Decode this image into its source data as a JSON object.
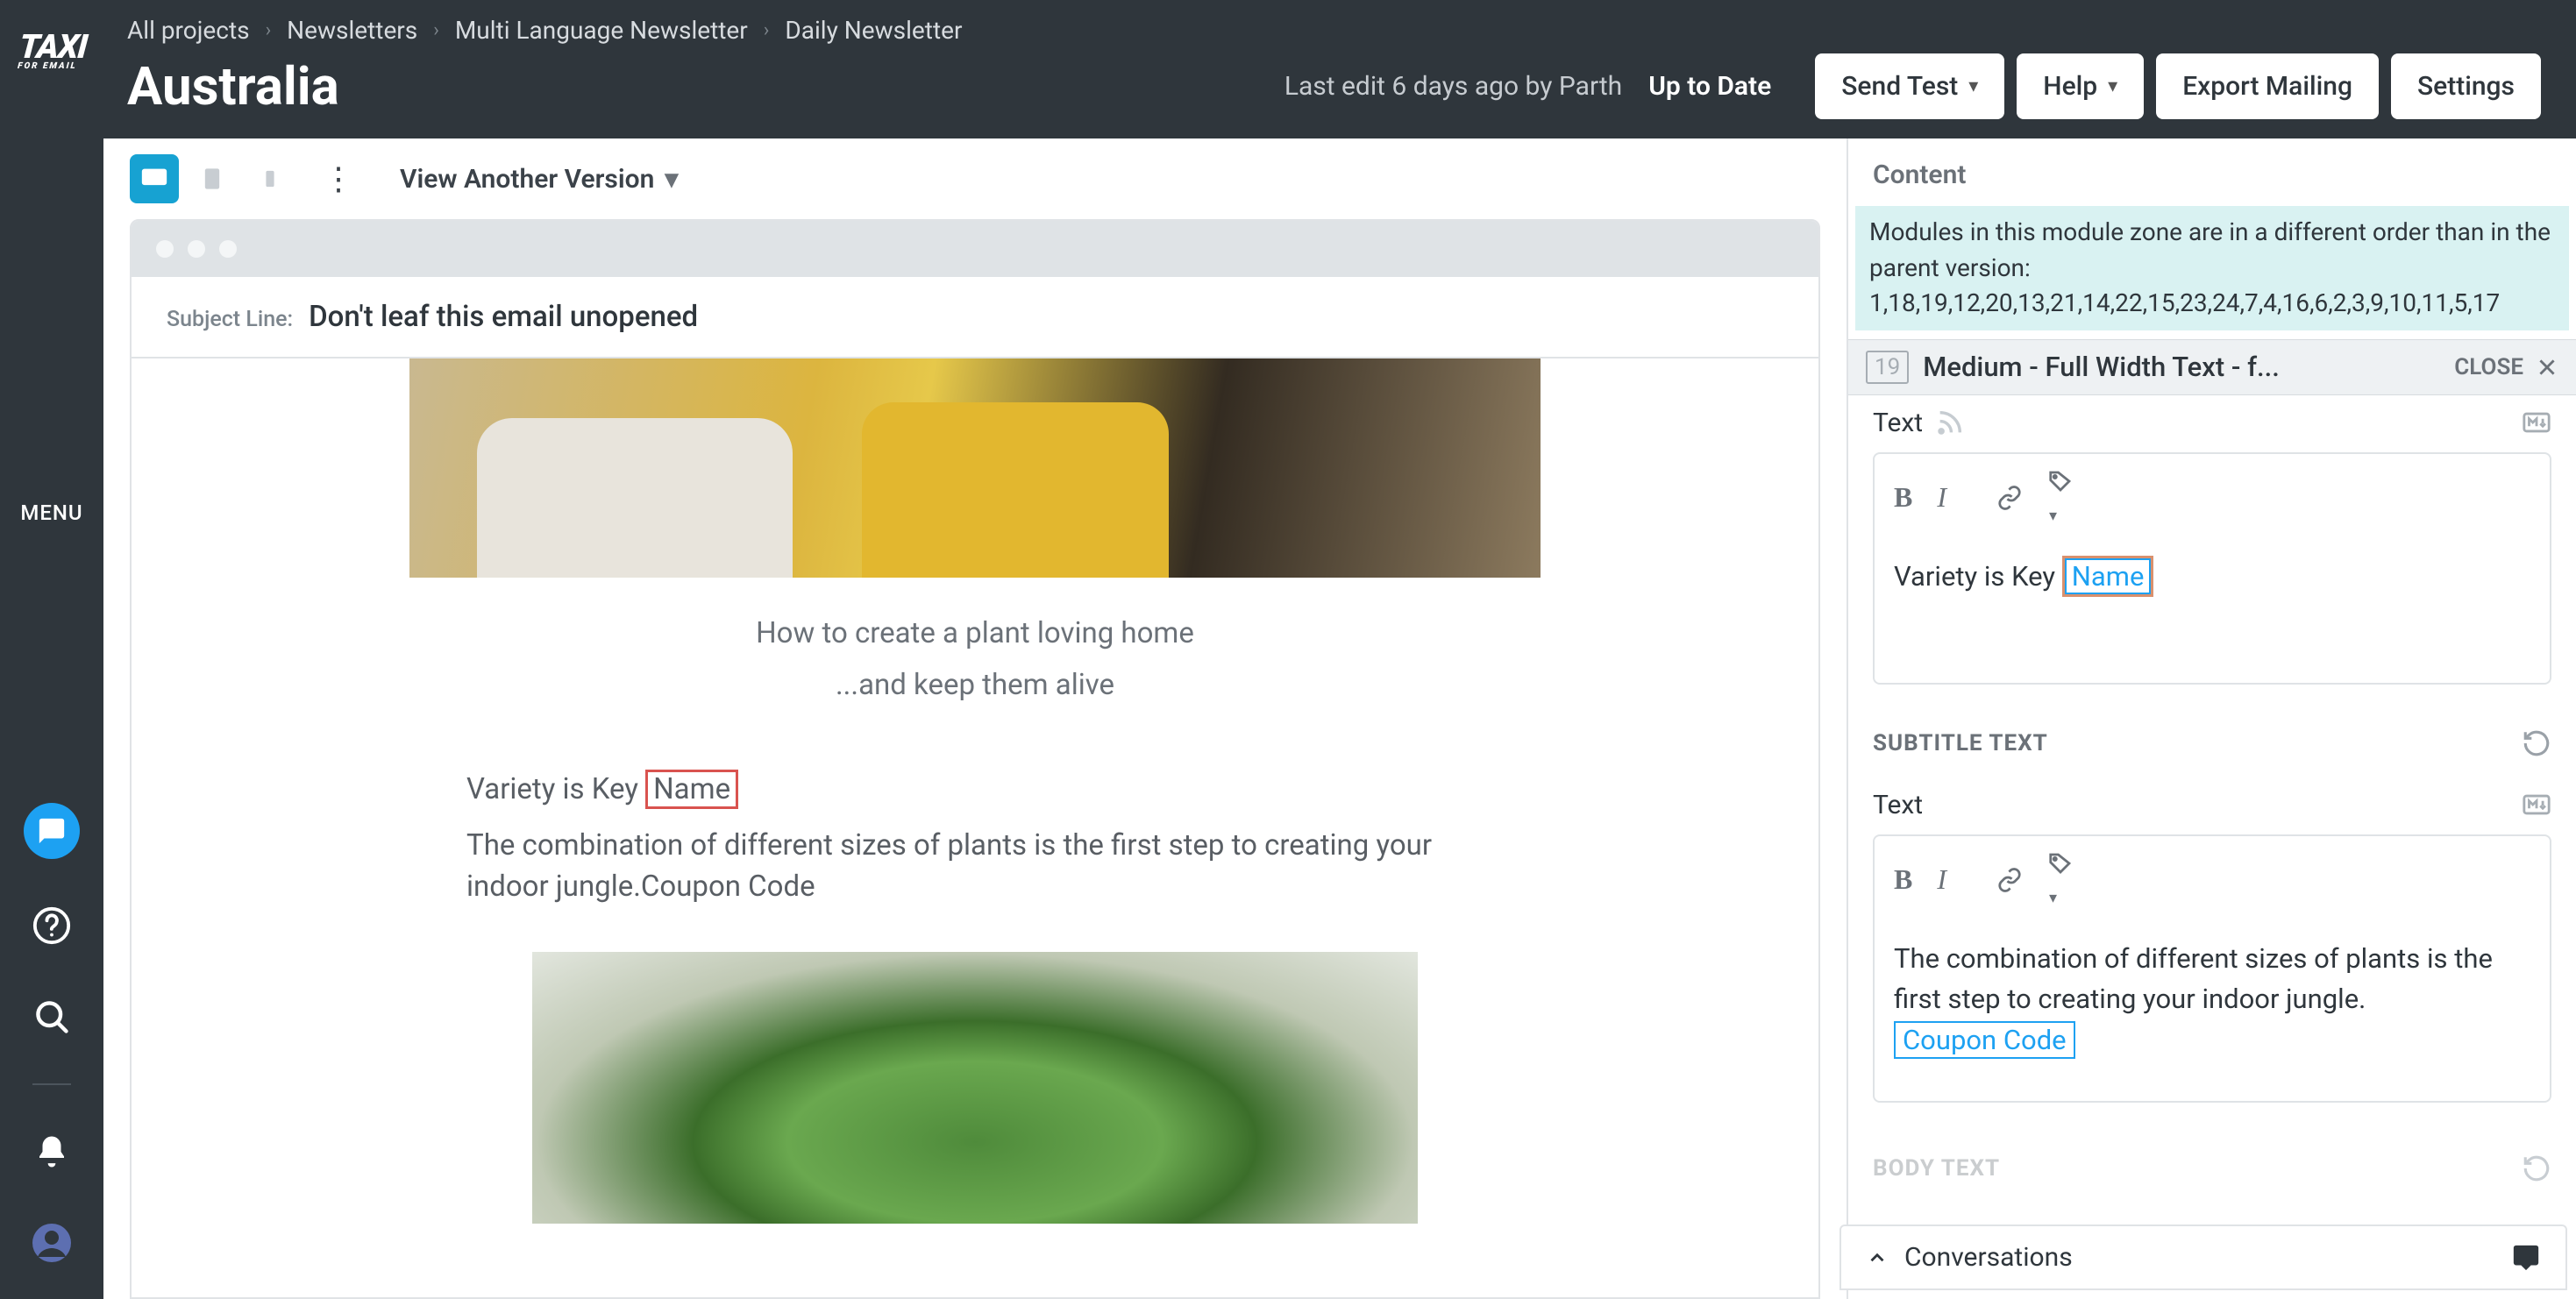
{
  "breadcrumbs": [
    "All projects",
    "Newsletters",
    "Multi Language Newsletter",
    "Daily Newsletter"
  ],
  "page_title": "Australia",
  "last_edit": "Last edit 6 days ago by Parth",
  "status": "Up to Date",
  "buttons": {
    "send_test": "Send Test",
    "help": "Help",
    "export": "Export Mailing",
    "settings": "Settings"
  },
  "left_rail": {
    "logo": "TAXI",
    "menu": "MENU"
  },
  "toolbar": {
    "view_version": "View Another Version"
  },
  "subject": {
    "label": "Subject Line:",
    "value": "Don't leaf this email unopened"
  },
  "email": {
    "h1": "How to create a plant loving home",
    "h2": "...and keep them alive",
    "variety_pre": "Variety is Key ",
    "variety_tag": "Name",
    "body_text": "The combination of different sizes of plants is the first step to creating your indoor jungle.Coupon Code"
  },
  "inspector": {
    "tab": "Content",
    "alert_line1": "Modules in this module zone are in a different order than in the parent version:",
    "alert_line2": "1,18,19,12,20,13,21,14,22,15,23,24,7,4,16,6,2,3,9,10,11,5,17",
    "module_number": "19",
    "module_title": "Medium - Full Width Text - f...",
    "close": "CLOSE",
    "text_label": "Text",
    "subtitle_label": "SUBTITLE TEXT",
    "body_label": "BODY TEXT",
    "editor1_pre": "Variety is Key ",
    "editor1_tag": "Name",
    "editor2_text": "The combination of different sizes of plants is the first step to creating your indoor jungle.",
    "editor2_tag": "Coupon Code"
  },
  "conversations": "Conversations"
}
